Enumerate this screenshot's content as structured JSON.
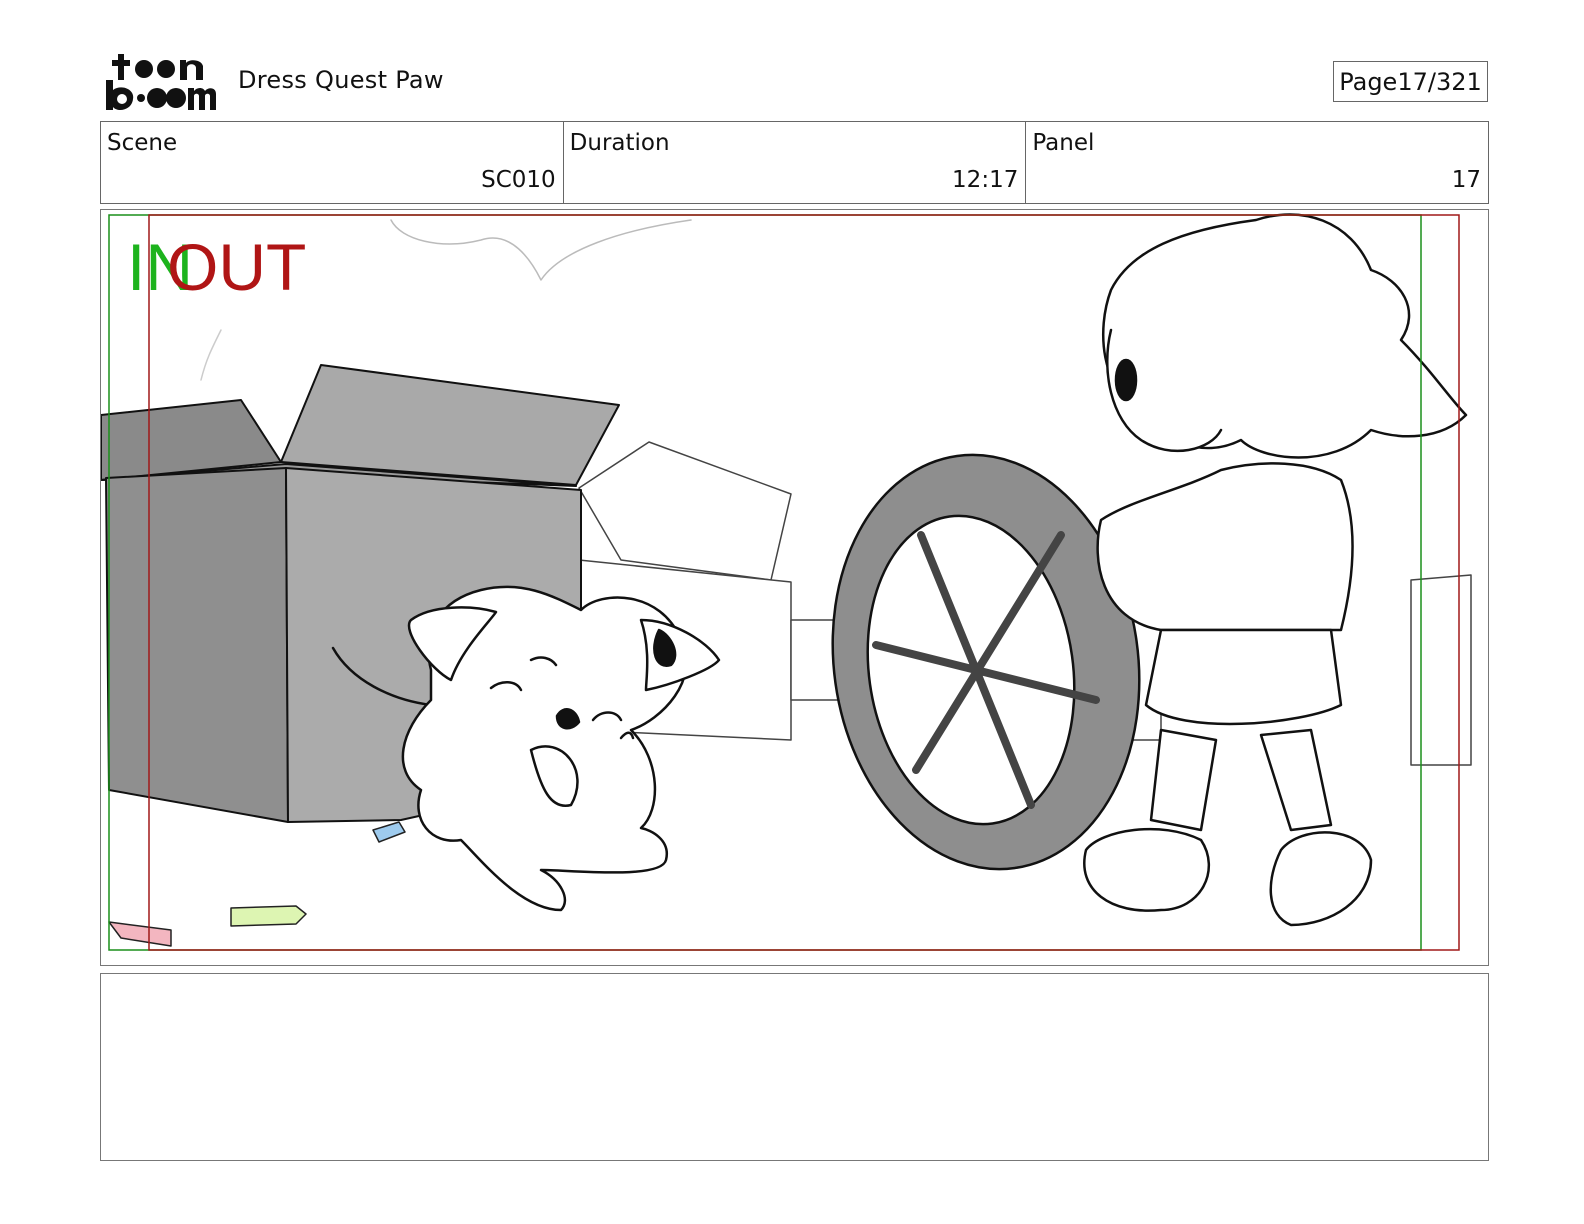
{
  "header": {
    "logo_text": "toon boom",
    "project_title": "Dress Quest Paw",
    "page_label": "Page",
    "page_value": "17/321"
  },
  "info": {
    "scene_label": "Scene",
    "scene_value": "SC010",
    "duration_label": "Duration",
    "duration_value": "12:17",
    "panel_label": "Panel",
    "panel_value": "17"
  },
  "panel": {
    "in_marker": "IN",
    "out_marker": "OUT",
    "in_color": "#1db31d",
    "out_color": "#b01515"
  },
  "notes": {
    "text": ""
  }
}
